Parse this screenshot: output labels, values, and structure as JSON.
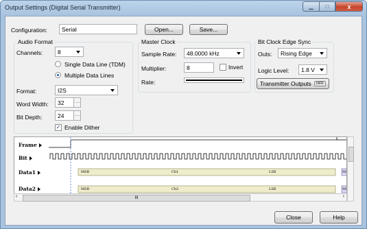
{
  "window": {
    "title": "Output Settings (Digital Serial Transmitter)",
    "min": "▁",
    "max": "□",
    "close": "x"
  },
  "config": {
    "label": "Configuration:",
    "value": "Serial",
    "open": "Open...",
    "save": "Save..."
  },
  "audio": {
    "title": "Audio Format",
    "channels_label": "Channels:",
    "channels_value": "8",
    "single_line": "Single Data Line (TDM)",
    "multiple_lines": "Multiple Data Lines",
    "format_label": "Format:",
    "format_value": "I2S",
    "word_width_label": "Word Width:",
    "word_width_value": "32",
    "bit_depth_label": "Bit Depth:",
    "bit_depth_value": "24",
    "dither_label": "Enable Dither"
  },
  "master": {
    "title": "Master Clock",
    "rate_label": "Sample Rate:",
    "rate_value": "48.0000 kHz",
    "mult_label": "Multiplier:",
    "mult_value": "8",
    "invert_label": "Invert",
    "rate2_label": "Rate:"
  },
  "bitclock": {
    "title": "Bit Clock Edge Sync",
    "outs_label": "Outs:",
    "outs_value": "Rising Edge",
    "logic_label": "Logic Level:",
    "logic_value": "1.8 V",
    "tx_label": "Transmitter Outputs",
    "tx_state": "OFF"
  },
  "timing": {
    "signals": [
      "Frame",
      "Bit",
      "Data1",
      "Data2"
    ],
    "data1_labels": [
      "MSB",
      "Ch1",
      "LSB",
      "MS"
    ],
    "data2_labels": [
      "MSB",
      "Ch3",
      "LSB",
      "MS"
    ],
    "scroll_grip": "III"
  },
  "footer": {
    "close": "Close",
    "help": "Help"
  }
}
